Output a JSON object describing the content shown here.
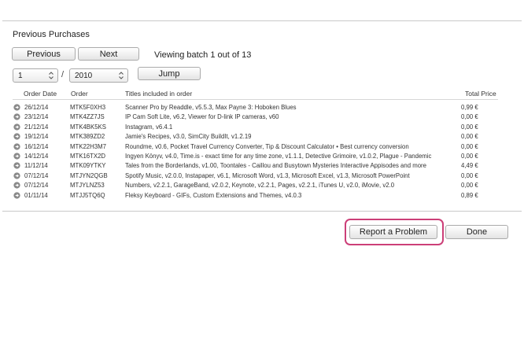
{
  "section_title": "Previous Purchases",
  "nav": {
    "previous_label": "Previous",
    "next_label": "Next",
    "batch_text": "Viewing batch 1 out of 13"
  },
  "jump": {
    "page_value": "1",
    "separator": "/",
    "year_value": "2010",
    "jump_label": "Jump"
  },
  "table": {
    "headers": {
      "order_date": "Order Date",
      "order": "Order",
      "titles": "Titles included in order",
      "total_price": "Total Price"
    },
    "rows": [
      {
        "date": "26/12/14",
        "order": "MTK5F0XH3",
        "titles": "Scanner Pro by Readdle, v5.5.3, Max Payne 3: Hoboken Blues",
        "price": "0,99 €"
      },
      {
        "date": "23/12/14",
        "order": "MTK4ZZ7JS",
        "titles": "IP Cam Soft Lite, v6.2, Viewer for D-link IP cameras, v60",
        "price": "0,00 €"
      },
      {
        "date": "21/12/14",
        "order": "MTK4BK5KS",
        "titles": "Instagram, v6.4.1",
        "price": "0,00 €"
      },
      {
        "date": "19/12/14",
        "order": "MTK389ZD2",
        "titles": "Jamie's Recipes, v3.0, SimCity BuildIt, v1.2.19",
        "price": "0,00 €"
      },
      {
        "date": "16/12/14",
        "order": "MTK22H3M7",
        "titles": "Roundme, v0.6, Pocket Travel Currency Converter, Tip & Discount Calculator • Best currency conversion",
        "price": "0,00 €"
      },
      {
        "date": "14/12/14",
        "order": "MTK16TX2D",
        "titles": "Ingyen Könyv, v4.0, Time.is - exact time for any time zone, v1.1.1, Detective Grimoire, v1.0.2, Plague - Pandemic",
        "price": "0,00 €"
      },
      {
        "date": "11/12/14",
        "order": "MTK09YTKY",
        "titles": "Tales from the Borderlands, v1.00, Toontales - Caillou and Busytown Mysteries Interactive Appisodes and more",
        "price": "4,49 €"
      },
      {
        "date": "07/12/14",
        "order": "MTJYN2QGB",
        "titles": "Spotify Music, v2.0.0, Instapaper, v6.1, Microsoft Word, v1.3, Microsoft Excel, v1.3, Microsoft PowerPoint",
        "price": "0,00 €"
      },
      {
        "date": "07/12/14",
        "order": "MTJYLNZ53",
        "titles": "Numbers, v2.2.1, GarageBand, v2.0.2, Keynote, v2.2.1, Pages, v2.2.1, iTunes U, v2.0, iMovie, v2.0",
        "price": "0,00 €"
      },
      {
        "date": "01/11/14",
        "order": "MTJJ5TQ6Q",
        "titles": "Fleksy Keyboard - GIFs, Custom Extensions and Themes, v4.0.3",
        "price": "0,89 €"
      }
    ]
  },
  "footer": {
    "report_label": "Report a Problem",
    "done_label": "Done"
  },
  "colors": {
    "highlight_ring": "#cc3f78",
    "arrow_icon": "#8a8a8a"
  }
}
